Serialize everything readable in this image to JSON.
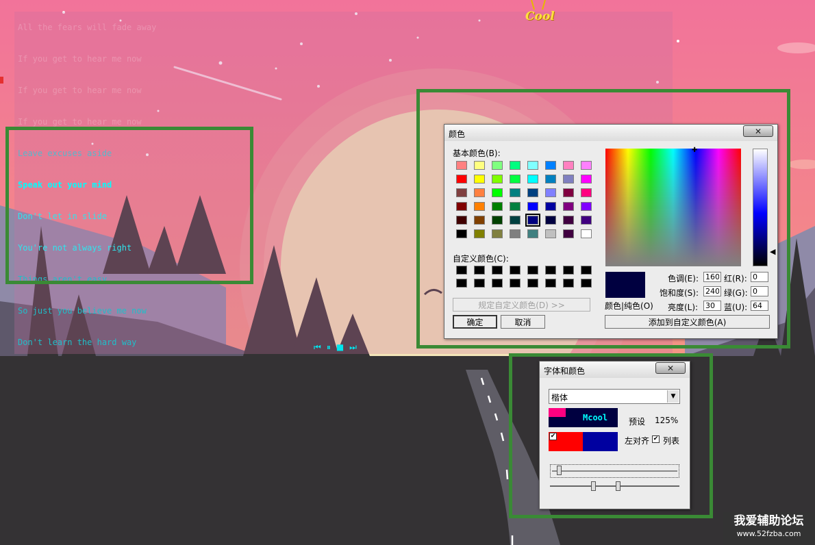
{
  "lyrics": [
    "All the fears will fade away",
    "If you get to hear me now",
    "If you get to hear me now",
    "If you get to hear me now",
    "Leave excuses aside",
    "Speak out your mind",
    "Don't let in slide",
    "You're not always right",
    "Things aren't easy",
    "So just you believe me now",
    "Don't learn the hard way"
  ],
  "current_lyric_index": 5,
  "player": {
    "prev_icon": "skip-previous-icon",
    "pause_icon": "pause-icon",
    "stop_icon": "stop-icon",
    "next_icon": "skip-next-icon"
  },
  "badge_text": "Cool",
  "color_dialog": {
    "title": "颜色",
    "close_label": "✕",
    "basic_colors_label": "基本颜色(B):",
    "basic_colors": [
      "#ff8080",
      "#ffff80",
      "#80ff80",
      "#00ff80",
      "#80ffff",
      "#0080ff",
      "#ff80c0",
      "#ff80ff",
      "#ff0000",
      "#ffff00",
      "#80ff00",
      "#00ff40",
      "#00ffff",
      "#0080c0",
      "#8080c0",
      "#ff00ff",
      "#804040",
      "#ff8040",
      "#00ff00",
      "#008080",
      "#004080",
      "#8080ff",
      "#800040",
      "#ff0080",
      "#800000",
      "#ff8000",
      "#008000",
      "#008040",
      "#0000ff",
      "#0000a0",
      "#800080",
      "#8000ff",
      "#400000",
      "#804000",
      "#004000",
      "#004040",
      "#000080",
      "#000040",
      "#400040",
      "#400080",
      "#000000",
      "#808000",
      "#808040",
      "#808080",
      "#408080",
      "#c0c0c0",
      "#400040",
      "#ffffff"
    ],
    "selected_basic_index": 36,
    "custom_colors_label": "自定义颜色(C):",
    "custom_colors": [
      "#000000",
      "#000000",
      "#000000",
      "#000000",
      "#000000",
      "#000000",
      "#000000",
      "#000000",
      "#000000",
      "#000000",
      "#000000",
      "#000000",
      "#000000",
      "#000000",
      "#000000",
      "#000000"
    ],
    "define_custom_label": "规定自定义颜色(D) >>",
    "ok_label": "确定",
    "cancel_label": "取消",
    "color_solid_label": "颜色|纯色(O)",
    "current_color": "#000040",
    "hue_label": "色调(E):",
    "hue": "160",
    "sat_label": "饱和度(S):",
    "sat": "240",
    "lum_label": "亮度(L):",
    "lum": "30",
    "red_label": "红(R):",
    "red": "0",
    "green_label": "绿(G):",
    "green": "0",
    "blue_label": "蓝(U):",
    "blue": "64",
    "add_custom_label": "添加到自定义颜色(A)"
  },
  "font_dialog": {
    "title": "字体和颜色",
    "close_label": "✕",
    "font_name": "楷体",
    "preview_text": "Mcool",
    "preset_label": "预设",
    "zoom": "125%",
    "left_align_label": "左对齐",
    "list_label": "列表",
    "left_align_checked": true,
    "list_checked": true,
    "highlight_color": "#ff0080",
    "preview_bg": "#000040",
    "preview_text_color": "#00ffff",
    "left_swatch_color": "#ff0000",
    "right_swatch_color": "#0000a0",
    "slider_top": 0.05,
    "slider_bottom_1": 0.33,
    "slider_bottom_2": 0.53
  },
  "watermark": {
    "line1": "我爱辅助论坛",
    "line2": "www.52fzba.com"
  }
}
